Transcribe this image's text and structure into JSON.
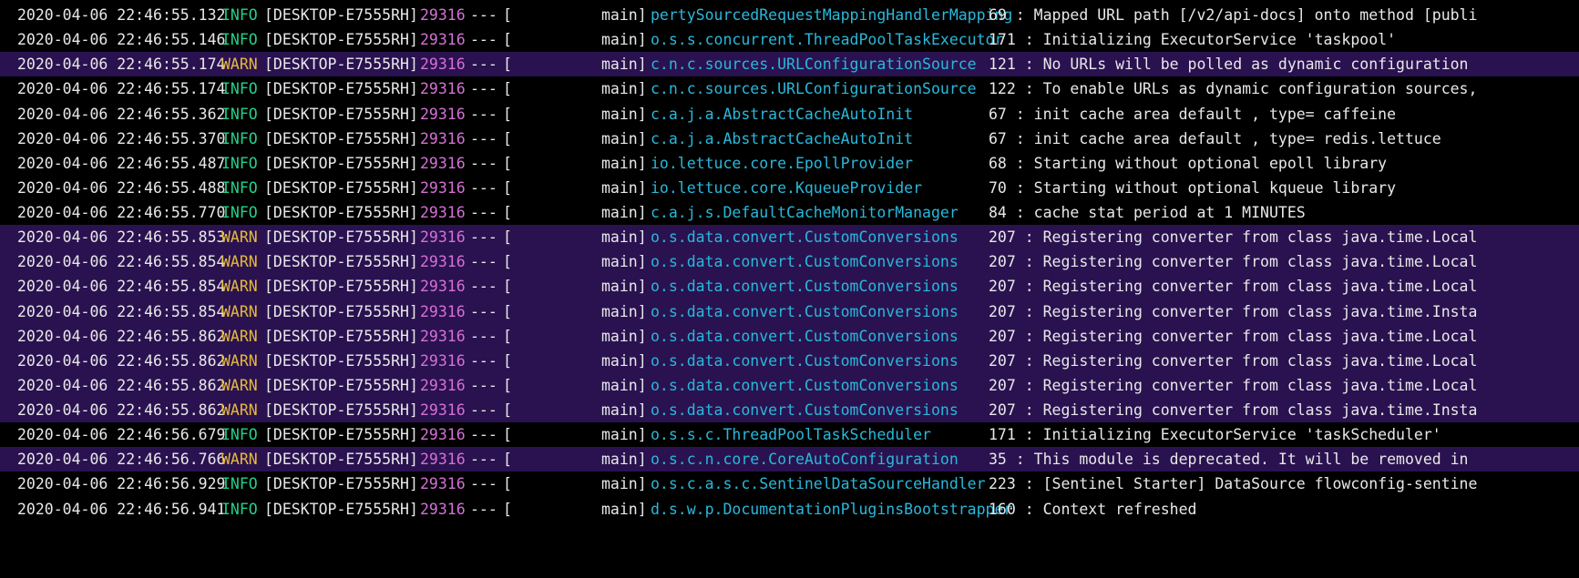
{
  "console": {
    "lines": [
      {
        "timestamp": "2020-04-06 22:46:55.132",
        "level": "INFO",
        "host": "[DESKTOP-E7555RH]",
        "pid": "29316",
        "sep": "---",
        "bracket": "[",
        "thread": "main]",
        "logger": "pertySourcedRequestMappingHandlerMapping",
        "message": "69 : Mapped URL path [/v2/api-docs] onto method [publi"
      },
      {
        "timestamp": "2020-04-06 22:46:55.146",
        "level": "INFO",
        "host": "[DESKTOP-E7555RH]",
        "pid": "29316",
        "sep": "---",
        "bracket": "[",
        "thread": "main]",
        "logger": "o.s.s.concurrent.ThreadPoolTaskExecutor",
        "message": "171 : Initializing ExecutorService 'taskpool'"
      },
      {
        "timestamp": "2020-04-06 22:46:55.174",
        "level": "WARN",
        "host": "[DESKTOP-E7555RH]",
        "pid": "29316",
        "sep": "---",
        "bracket": "[",
        "thread": "main]",
        "logger": "c.n.c.sources.URLConfigurationSource",
        "message": "121 : No URLs will be polled as dynamic configuration"
      },
      {
        "timestamp": "2020-04-06 22:46:55.174",
        "level": "INFO",
        "host": "[DESKTOP-E7555RH]",
        "pid": "29316",
        "sep": "---",
        "bracket": "[",
        "thread": "main]",
        "logger": "c.n.c.sources.URLConfigurationSource",
        "message": "122 : To enable URLs as dynamic configuration sources,"
      },
      {
        "timestamp": "2020-04-06 22:46:55.362",
        "level": "INFO",
        "host": "[DESKTOP-E7555RH]",
        "pid": "29316",
        "sep": "---",
        "bracket": "[",
        "thread": "main]",
        "logger": "c.a.j.a.AbstractCacheAutoInit",
        "message": "67 : init cache area default , type= caffeine"
      },
      {
        "timestamp": "2020-04-06 22:46:55.370",
        "level": "INFO",
        "host": "[DESKTOP-E7555RH]",
        "pid": "29316",
        "sep": "---",
        "bracket": "[",
        "thread": "main]",
        "logger": "c.a.j.a.AbstractCacheAutoInit",
        "message": "67 : init cache area default , type= redis.lettuce"
      },
      {
        "timestamp": "2020-04-06 22:46:55.487",
        "level": "INFO",
        "host": "[DESKTOP-E7555RH]",
        "pid": "29316",
        "sep": "---",
        "bracket": "[",
        "thread": "main]",
        "logger": "io.lettuce.core.EpollProvider",
        "message": "68 : Starting without optional epoll library"
      },
      {
        "timestamp": "2020-04-06 22:46:55.488",
        "level": "INFO",
        "host": "[DESKTOP-E7555RH]",
        "pid": "29316",
        "sep": "---",
        "bracket": "[",
        "thread": "main]",
        "logger": "io.lettuce.core.KqueueProvider",
        "message": "70 : Starting without optional kqueue library"
      },
      {
        "timestamp": "2020-04-06 22:46:55.770",
        "level": "INFO",
        "host": "[DESKTOP-E7555RH]",
        "pid": "29316",
        "sep": "---",
        "bracket": "[",
        "thread": "main]",
        "logger": "c.a.j.s.DefaultCacheMonitorManager",
        "message": "84 : cache stat period at 1 MINUTES"
      },
      {
        "timestamp": "2020-04-06 22:46:55.853",
        "level": "WARN",
        "host": "[DESKTOP-E7555RH]",
        "pid": "29316",
        "sep": "---",
        "bracket": "[",
        "thread": "main]",
        "logger": "o.s.data.convert.CustomConversions",
        "message": "207 : Registering converter from class java.time.Local"
      },
      {
        "timestamp": "2020-04-06 22:46:55.854",
        "level": "WARN",
        "host": "[DESKTOP-E7555RH]",
        "pid": "29316",
        "sep": "---",
        "bracket": "[",
        "thread": "main]",
        "logger": "o.s.data.convert.CustomConversions",
        "message": "207 : Registering converter from class java.time.Local"
      },
      {
        "timestamp": "2020-04-06 22:46:55.854",
        "level": "WARN",
        "host": "[DESKTOP-E7555RH]",
        "pid": "29316",
        "sep": "---",
        "bracket": "[",
        "thread": "main]",
        "logger": "o.s.data.convert.CustomConversions",
        "message": "207 : Registering converter from class java.time.Local"
      },
      {
        "timestamp": "2020-04-06 22:46:55.854",
        "level": "WARN",
        "host": "[DESKTOP-E7555RH]",
        "pid": "29316",
        "sep": "---",
        "bracket": "[",
        "thread": "main]",
        "logger": "o.s.data.convert.CustomConversions",
        "message": "207 : Registering converter from class java.time.Insta"
      },
      {
        "timestamp": "2020-04-06 22:46:55.862",
        "level": "WARN",
        "host": "[DESKTOP-E7555RH]",
        "pid": "29316",
        "sep": "---",
        "bracket": "[",
        "thread": "main]",
        "logger": "o.s.data.convert.CustomConversions",
        "message": "207 : Registering converter from class java.time.Local"
      },
      {
        "timestamp": "2020-04-06 22:46:55.862",
        "level": "WARN",
        "host": "[DESKTOP-E7555RH]",
        "pid": "29316",
        "sep": "---",
        "bracket": "[",
        "thread": "main]",
        "logger": "o.s.data.convert.CustomConversions",
        "message": "207 : Registering converter from class java.time.Local"
      },
      {
        "timestamp": "2020-04-06 22:46:55.862",
        "level": "WARN",
        "host": "[DESKTOP-E7555RH]",
        "pid": "29316",
        "sep": "---",
        "bracket": "[",
        "thread": "main]",
        "logger": "o.s.data.convert.CustomConversions",
        "message": "207 : Registering converter from class java.time.Local"
      },
      {
        "timestamp": "2020-04-06 22:46:55.862",
        "level": "WARN",
        "host": "[DESKTOP-E7555RH]",
        "pid": "29316",
        "sep": "---",
        "bracket": "[",
        "thread": "main]",
        "logger": "o.s.data.convert.CustomConversions",
        "message": "207 : Registering converter from class java.time.Insta"
      },
      {
        "timestamp": "2020-04-06 22:46:56.679",
        "level": "INFO",
        "host": "[DESKTOP-E7555RH]",
        "pid": "29316",
        "sep": "---",
        "bracket": "[",
        "thread": "main]",
        "logger": "o.s.s.c.ThreadPoolTaskScheduler",
        "message": "171 : Initializing ExecutorService 'taskScheduler'"
      },
      {
        "timestamp": "2020-04-06 22:46:56.766",
        "level": "WARN",
        "host": "[DESKTOP-E7555RH]",
        "pid": "29316",
        "sep": "---",
        "bracket": "[",
        "thread": "main]",
        "logger": "o.s.c.n.core.CoreAutoConfiguration",
        "message": "35 : This module is deprecated. It will be removed in"
      },
      {
        "timestamp": "2020-04-06 22:46:56.929",
        "level": "INFO",
        "host": "[DESKTOP-E7555RH]",
        "pid": "29316",
        "sep": "---",
        "bracket": "[",
        "thread": "main]",
        "logger": "o.s.c.a.s.c.SentinelDataSourceHandler",
        "message": "223 : [Sentinel Starter] DataSource flowconfig-sentine"
      },
      {
        "timestamp": "2020-04-06 22:46:56.941",
        "level": "INFO",
        "host": "[DESKTOP-E7555RH]",
        "pid": "29316",
        "sep": "---",
        "bracket": "[",
        "thread": "main]",
        "logger": "d.s.w.p.DocumentationPluginsBootstrapper",
        "message": "160 : Context refreshed"
      }
    ]
  },
  "colors": {
    "background": "#000000",
    "warn_row_background": "#2a1250",
    "info_level": "#23d18b",
    "warn_level": "#e5b93b",
    "pid": "#d670d6",
    "logger": "#29b8db",
    "text": "#e8e8e8"
  }
}
